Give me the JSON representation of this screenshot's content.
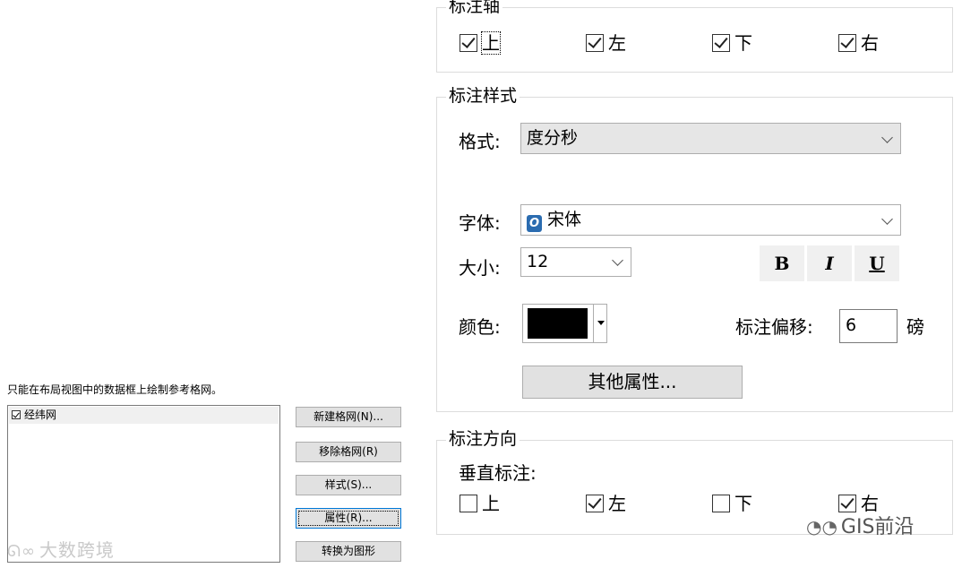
{
  "grid_panel": {
    "note": "只能在布局视图中的数据框上绘制参考格网。",
    "items": [
      {
        "label": "经纬网",
        "checked": true
      }
    ],
    "buttons": {
      "new_grid": "新建格网(N)...",
      "remove_grid": "移除格网(R)",
      "style": "样式(S)...",
      "properties": "属性(R)...",
      "convert": "转换为图形"
    }
  },
  "label_axes": {
    "title": "标注轴",
    "top": {
      "label": "上",
      "checked": true
    },
    "left": {
      "label": "左",
      "checked": true
    },
    "bottom": {
      "label": "下",
      "checked": true
    },
    "right": {
      "label": "右",
      "checked": true
    }
  },
  "label_style": {
    "title": "标注样式",
    "format_label": "格式:",
    "format_value": "度分秒",
    "font_label": "字体:",
    "font_value": "宋体",
    "size_label": "大小:",
    "size_value": "12",
    "bold": "B",
    "italic": "I",
    "underline": "U",
    "color_label": "颜色:",
    "color_value": "#000000",
    "offset_label": "标注偏移:",
    "offset_value": "6",
    "offset_unit": "磅",
    "more_button": "其他属性..."
  },
  "label_orientation": {
    "title": "标注方向",
    "vertical_label": "垂直标注:",
    "top": {
      "label": "上",
      "checked": false
    },
    "left": {
      "label": "左",
      "checked": true
    },
    "bottom": {
      "label": "下",
      "checked": false
    },
    "right": {
      "label": "右",
      "checked": true
    }
  },
  "watermarks": {
    "left": "大数跨境",
    "right": "GIS前沿"
  }
}
